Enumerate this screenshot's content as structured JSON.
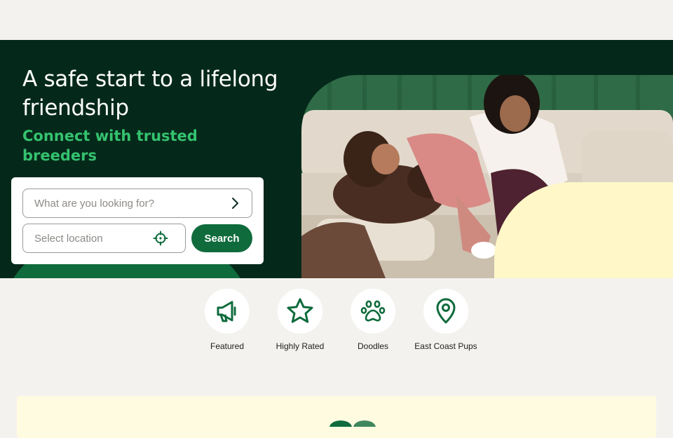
{
  "hero": {
    "title": "A safe start to a lifelong friendship",
    "subtitle": "Connect with trusted breeders"
  },
  "search": {
    "what_placeholder": "What are you looking for?",
    "location_placeholder": "Select location",
    "button_label": "Search"
  },
  "categories": [
    {
      "label": "Featured",
      "icon": "megaphone-icon"
    },
    {
      "label": "Highly Rated",
      "icon": "star-icon"
    },
    {
      "label": "Doodles",
      "icon": "paw-icon"
    },
    {
      "label": "East Coast Pups",
      "icon": "location-pin-icon"
    }
  ],
  "colors": {
    "hero_bg": "#04291a",
    "accent_green": "#0f6b3c",
    "subtitle_green": "#35c26f",
    "cream": "#fff7c8",
    "page_bg": "#f4f2ef"
  }
}
